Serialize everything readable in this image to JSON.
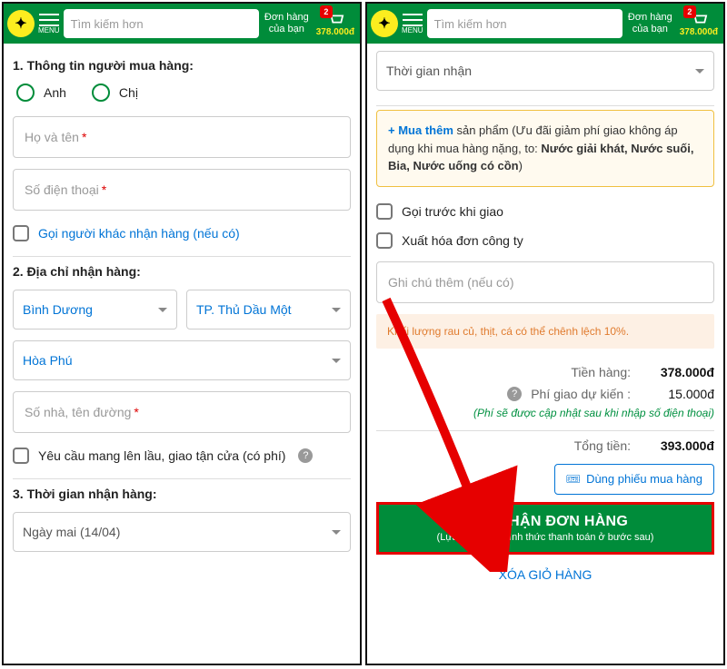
{
  "header": {
    "menu_label": "MENU",
    "search_placeholder": "Tìm kiếm hơn",
    "order_link_line1": "Đơn hàng",
    "order_link_line2": "của bạn",
    "cart_badge": "2",
    "cart_price": "378.000đ"
  },
  "left": {
    "section1_title": "1. Thông tin người mua hàng:",
    "radio_anh": "Anh",
    "radio_chi": "Chị",
    "name_placeholder": "Họ và tên",
    "phone_placeholder": "Số điện thoại",
    "other_receiver": "Gọi người khác nhận hàng (nếu có)",
    "section2_title": "2. Địa chỉ nhận hàng:",
    "province": "Bình Dương",
    "city": "TP. Thủ Dầu Một",
    "ward": "Hòa Phú",
    "street_placeholder": "Số nhà, tên đường",
    "upstairs": "Yêu cầu mang lên lầu, giao tận cửa (có phí)",
    "section3_title": "3. Thời gian nhận hàng:",
    "date_select": "Ngày mai (14/04)"
  },
  "right": {
    "time_select": "Thời gian nhận",
    "promo_plus": "+ Mua thêm",
    "promo_text1": " sản phẩm (Ưu đãi giảm phí giao không áp dụng khi mua hàng nặng, to: ",
    "promo_bold": "Nước giải khát, Nước suối, Bia, Nước uống có cồn",
    "promo_close": ")",
    "call_before": "Gọi trước khi giao",
    "invoice": "Xuất hóa đơn công ty",
    "note_placeholder": "Ghi chú thêm (nếu có)",
    "weight_notice": "Khối lượng rau củ, thịt, cá có thể chênh lệch 10%.",
    "subtotal_label": "Tiền hàng:",
    "subtotal_val": "378.000đ",
    "ship_label": "Phí giao dự kiến :",
    "ship_val": "15.000đ",
    "ship_note": "(Phí sẽ được cập nhật sau khi nhập số điện thoại)",
    "total_label": "Tổng tiền:",
    "total_val": "393.000đ",
    "voucher_btn": "Dùng phiếu mua hàng",
    "confirm_title": "XÁC NHẬN ĐƠN HÀNG",
    "confirm_sub": "(Lựa chọn các hình thức thanh toán ở bước sau)",
    "clear_cart": "XÓA GIỎ HÀNG"
  }
}
